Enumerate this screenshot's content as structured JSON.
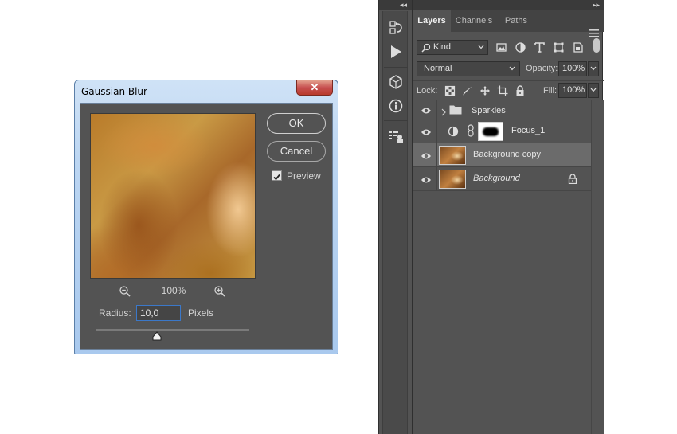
{
  "dialog": {
    "title": "Gaussian Blur",
    "close_label": "✕",
    "ok_label": "OK",
    "cancel_label": "Cancel",
    "preview_label": "Preview",
    "preview_checked": true,
    "zoom_value": "100%",
    "radius_label": "Radius:",
    "radius_value": "10,0",
    "radius_unit": "Pixels",
    "radius_slider_fraction": 0.4
  },
  "panel": {
    "tabs": [
      {
        "label": "Layers",
        "active": true
      },
      {
        "label": "Channels",
        "active": false
      },
      {
        "label": "Paths",
        "active": false
      }
    ],
    "filter_kind": "Kind",
    "blend_mode": "Normal",
    "opacity_label": "Opacity:",
    "opacity_value": "100%",
    "lock_label": "Lock:",
    "fill_label": "Fill:",
    "fill_value": "100%",
    "collapse_left": "◂◂",
    "collapse_right": "▸▸",
    "layers": [
      {
        "name": "Sparkles",
        "type": "group",
        "selected": false,
        "locked": false
      },
      {
        "name": "Focus_1",
        "type": "adjustment",
        "selected": false,
        "locked": false
      },
      {
        "name": "Background copy",
        "type": "pixel",
        "selected": true,
        "locked": false
      },
      {
        "name": "Background",
        "type": "pixel",
        "selected": false,
        "locked": true
      }
    ]
  },
  "colors": {
    "dialog_bg": "#535353",
    "panel_bg": "#535353",
    "selected_layer": "#6b6b6b",
    "focus_border": "#3b78c9",
    "close_button": "#c75050"
  }
}
